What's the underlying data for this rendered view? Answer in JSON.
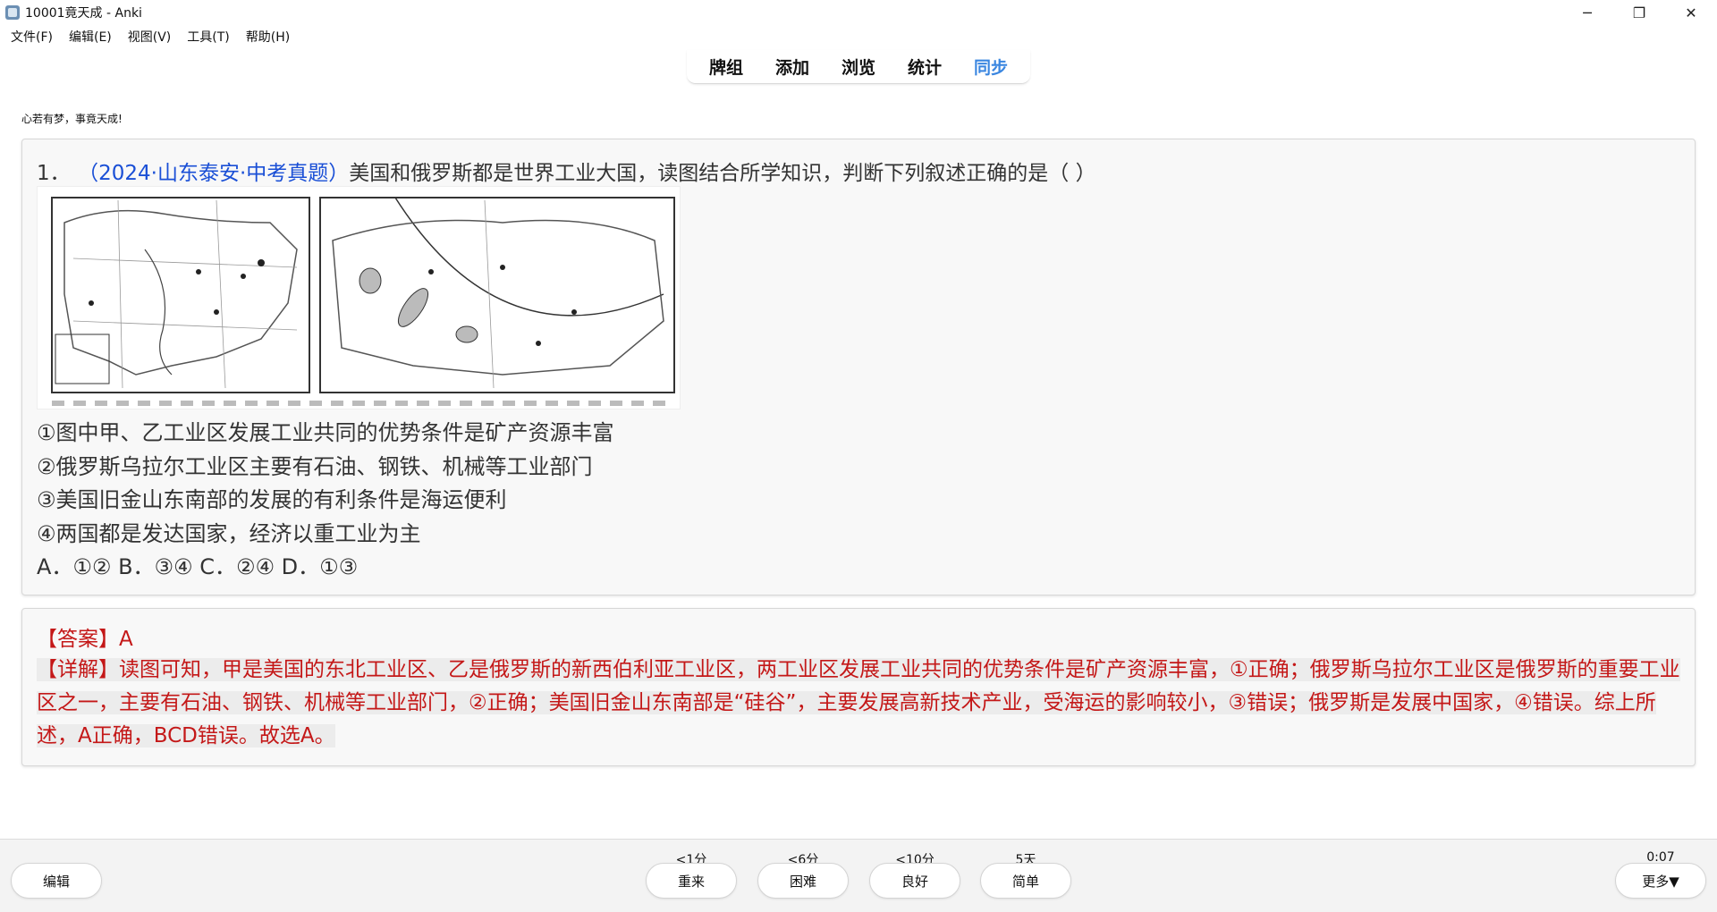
{
  "window": {
    "title": "10001竟天成 - Anki",
    "minimize": "─",
    "restore": "❐",
    "close": "✕"
  },
  "menu": [
    "文件(F)",
    "编辑(E)",
    "视图(V)",
    "工具(T)",
    "帮助(H)"
  ],
  "nav": {
    "tabs": [
      "牌组",
      "添加",
      "浏览",
      "统计",
      "同步"
    ],
    "active_index": 4,
    "active_color": "#3a86e0"
  },
  "motto": "心若有梦，事竟天成!",
  "question": {
    "number": "1．",
    "source": "（2024·山东泰安·中考真题）",
    "stem": "美国和俄罗斯都是世界工业大国，读图结合所学知识，判断下列叙述正确的是（    ）",
    "figure_icon": "map-image",
    "statements": [
      "①图中甲、乙工业区发展工业共同的优势条件是矿产资源丰富",
      "②俄罗斯乌拉尔工业区主要有石油、钢铁、机械等工业部门",
      "③美国旧金山东南部的发展的有利条件是海运便利",
      "④两国都是发达国家，经济以重工业为主"
    ],
    "choices": "A．①② B．③④ C．②④ D．①③"
  },
  "answer": {
    "answer_line": "【答案】A",
    "detail_label": "【详解】",
    "detail_text": "读图可知，甲是美国的东北工业区、乙是俄罗斯的新西伯利亚工业区，两工业区发展工业共同的优势条件是矿产资源丰富，①正确；俄罗斯乌拉尔工业区是俄罗斯的重要工业区之一，主要有石油、钢铁、机械等工业部门，②正确；美国旧金山东南部是“硅谷”，主要发展高新技术产业，受海运的影响较小，③错误；俄罗斯是发展中国家，④错误。综上所述，A正确，BCD错误。故选A。",
    "color": "#c41818"
  },
  "bottom": {
    "edit_label": "编辑",
    "more_label": "更多▼",
    "timer": "0:07",
    "ease_buttons": [
      {
        "label": "重来",
        "interval": "<1分"
      },
      {
        "label": "困难",
        "interval": "<6分"
      },
      {
        "label": "良好",
        "interval": "<10分"
      },
      {
        "label": "简单",
        "interval": "5天"
      }
    ]
  }
}
